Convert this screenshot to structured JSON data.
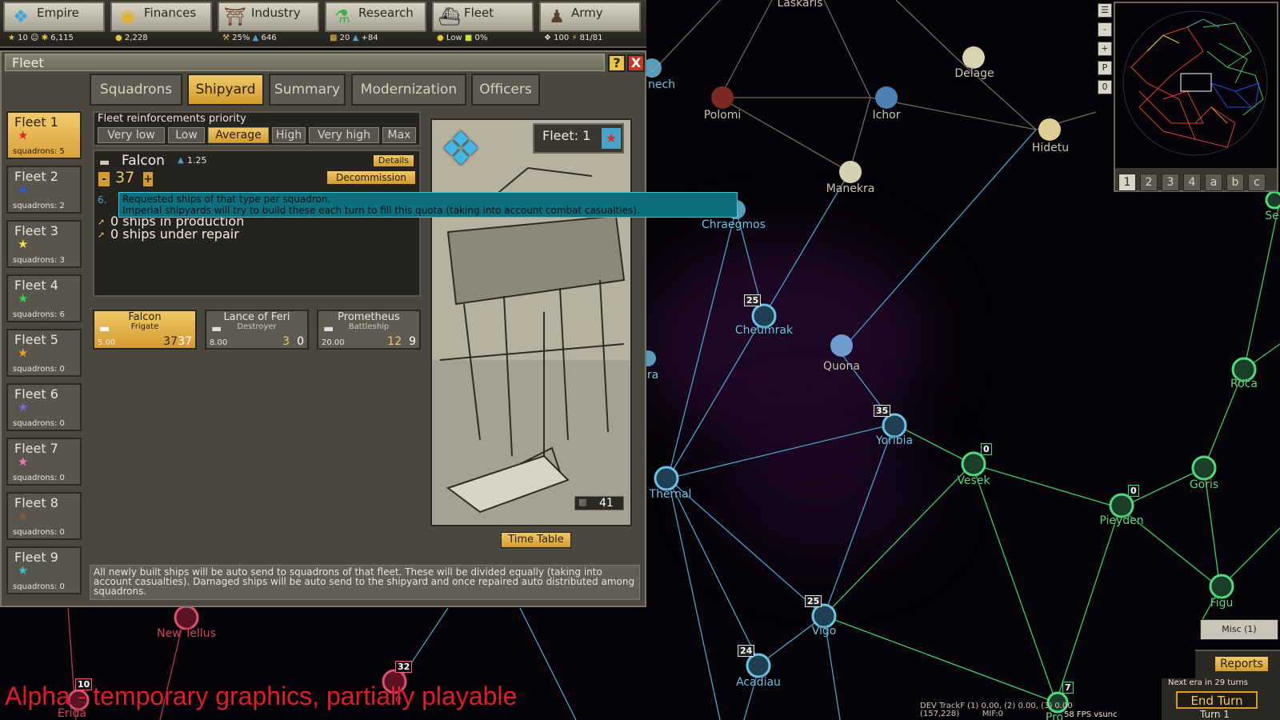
{
  "topbar": {
    "tabs": [
      {
        "label": "Empire",
        "icon": "eagle-icon"
      },
      {
        "label": "Finances",
        "icon": "coin-icon"
      },
      {
        "label": "Industry",
        "icon": "factory-icon"
      },
      {
        "label": "Research",
        "icon": "flask-icon"
      },
      {
        "label": "Fleet",
        "icon": "warship-icon"
      },
      {
        "label": "Army",
        "icon": "soldier-icon"
      }
    ],
    "stats": {
      "empire_a": "10",
      "empire_b": "6,115",
      "finances": "2,228",
      "industry_a": "25%",
      "industry_b": "646",
      "research_a": "20",
      "research_b": "+84",
      "fleet_a": "Low",
      "fleet_b": "0%",
      "army_a": "100",
      "army_b": "81/81"
    }
  },
  "window": {
    "title": "Fleet",
    "help": "?",
    "close": "X"
  },
  "subtabs": [
    "Squadrons",
    "Shipyard",
    "Summary",
    "Modernization",
    "Officers"
  ],
  "fleets": [
    {
      "name": "Fleet 1",
      "squadrons": "squadrons: 5",
      "color": "#e02a2a"
    },
    {
      "name": "Fleet 2",
      "squadrons": "squadrons: 2",
      "color": "#2a5ae0"
    },
    {
      "name": "Fleet 3",
      "squadrons": "squadrons: 3",
      "color": "#f0e040"
    },
    {
      "name": "Fleet 4",
      "squadrons": "squadrons: 6",
      "color": "#3ad04a"
    },
    {
      "name": "Fleet 5",
      "squadrons": "squadrons: 0",
      "color": "#f0a020"
    },
    {
      "name": "Fleet 6",
      "squadrons": "squadrons: 0",
      "color": "#8060e0"
    },
    {
      "name": "Fleet 7",
      "squadrons": "squadrons: 0",
      "color": "#f07ab0"
    },
    {
      "name": "Fleet 8",
      "squadrons": "squadrons: 0",
      "color": "#8a5a30"
    },
    {
      "name": "Fleet 9",
      "squadrons": "squadrons: 0",
      "color": "#30c0d0"
    }
  ],
  "priority": {
    "label": "Fleet reinforcements priority",
    "options": [
      "Very low",
      "Low",
      "Average",
      "High",
      "Very high",
      "Max"
    ]
  },
  "selected_ship": {
    "name": "Falcon",
    "value": "1.25",
    "details": "Details",
    "decommission": "Decommission",
    "minus": "-",
    "plus": "+",
    "quota": "37",
    "hidden_prefix": "6."
  },
  "production": {
    "in_production": "0 ships in production",
    "under_repair": "0 ships under repair"
  },
  "tooltip": {
    "line1": "Requested ships of that type per squadron.",
    "line2": "Imperial shipyards will try to build these each turn to fill this quota (taking into account combat casualties)."
  },
  "ship_cards": [
    {
      "name": "Falcon",
      "class": "Frigate",
      "cost": "5.00",
      "req": "37",
      "cur": "37"
    },
    {
      "name": "Lance of Feri",
      "class": "Destroyer",
      "cost": "8.00",
      "req": "3",
      "cur": "0"
    },
    {
      "name": "Prometheus",
      "class": "Battleship",
      "cost": "20.00",
      "req": "12",
      "cur": "9"
    }
  ],
  "art": {
    "fleet_label": "Fleet: 1",
    "count": "41"
  },
  "timetable": "Time Table",
  "info_text": "All newly built ships will be auto send to squadrons of that fleet. These will be divided equally (taking into account casualties). Damaged ships will be auto send to the shipyard and once repaired auto distributed among squadrons.",
  "systems": [
    {
      "name": "Laskaris",
      "color": "grey"
    },
    {
      "name": "Delage",
      "color": "grey"
    },
    {
      "name": "Polomi",
      "color": "grey"
    },
    {
      "name": "Ichor",
      "color": "grey"
    },
    {
      "name": "Hidetu",
      "color": "grey"
    },
    {
      "name": "Manekra",
      "color": "grey"
    },
    {
      "name": "Chraegmos",
      "color": "blue"
    },
    {
      "name": "Cheumrak",
      "color": "blue"
    },
    {
      "name": "Quona",
      "color": "grey"
    },
    {
      "name": "Yoribia",
      "color": "blue"
    },
    {
      "name": "Thernal",
      "color": "blue"
    },
    {
      "name": "Vesek",
      "color": "green"
    },
    {
      "name": "Pieyden",
      "color": "green"
    },
    {
      "name": "Goris",
      "color": "green"
    },
    {
      "name": "Roca",
      "color": "green"
    },
    {
      "name": "Figu",
      "color": "green"
    },
    {
      "name": "Vigo",
      "color": "blue"
    },
    {
      "name": "Acadiau",
      "color": "blue"
    },
    {
      "name": "New Tellus",
      "color": "red"
    },
    {
      "name": "Erida",
      "color": "red"
    },
    {
      "name": "nech",
      "color": "blue"
    },
    {
      "name": "Se",
      "color": "green"
    },
    {
      "name": "ra",
      "color": "blue"
    },
    {
      "name": "Pro",
      "color": "green"
    },
    {
      "name": "e",
      "color": "red"
    }
  ],
  "flags": [
    "25",
    "35",
    "0",
    "0",
    "25",
    "24",
    "32",
    "10",
    "7"
  ],
  "minimap": {
    "tabs": [
      "1",
      "2",
      "3",
      "4",
      "a",
      "b",
      "c"
    ],
    "side_buttons": [
      "-",
      "+",
      "P",
      "0"
    ]
  },
  "right_panel": {
    "misc": "Misc (1)",
    "reports": "Reports",
    "next_era": "Next era in 29 turns",
    "end_turn": "End Turn",
    "turn": "Turn 1"
  },
  "alpha_text": "Alpha - temporary graphics, partially playable",
  "dev_info": "DEV TrackF (1) 0.00, (2) 0.00, (3) 0.00\n(157,228)         MIF:0",
  "fps": "58 FPS vsunc"
}
